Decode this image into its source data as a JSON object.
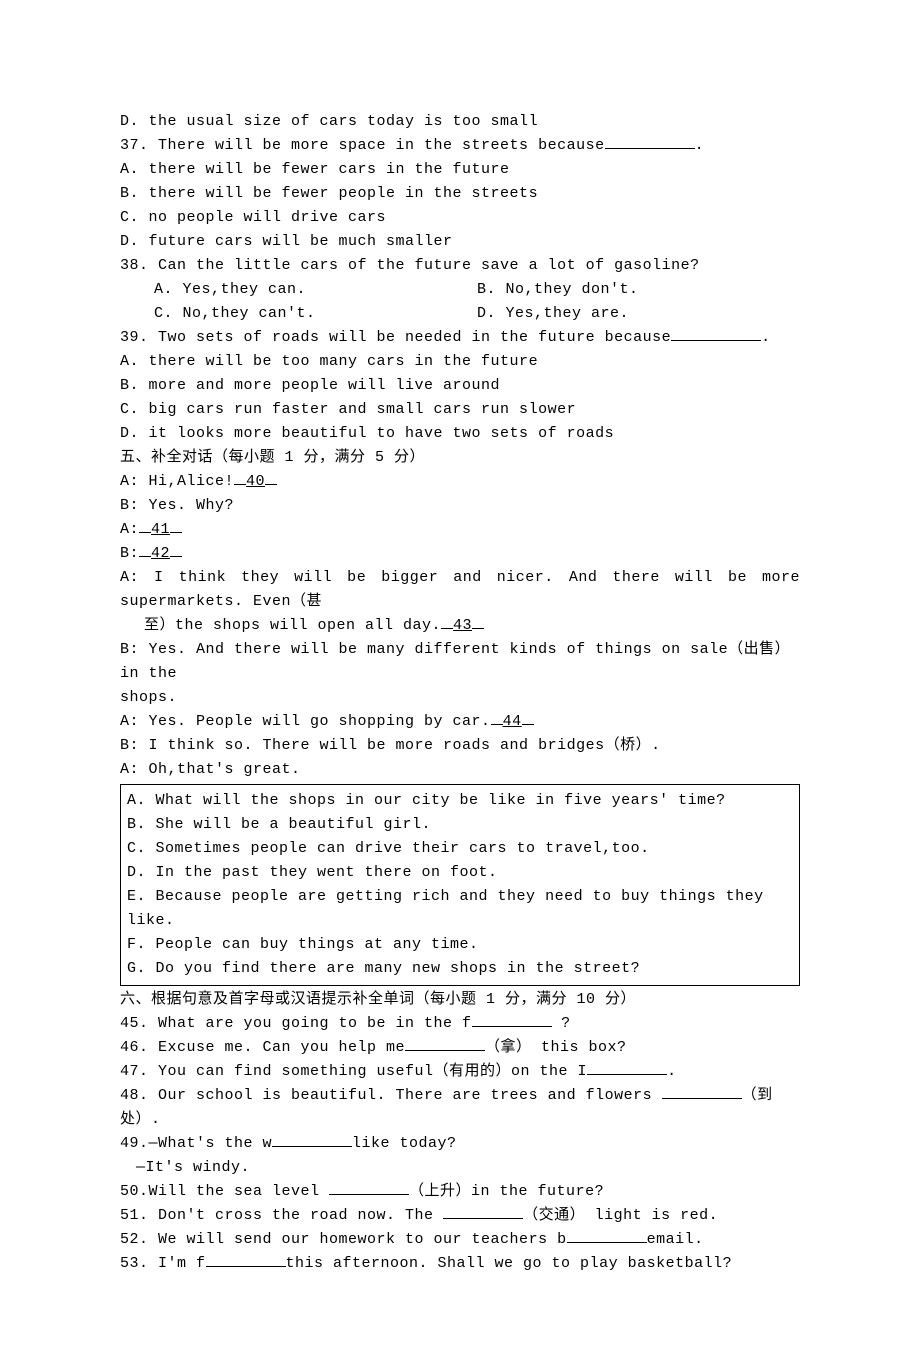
{
  "q36": {
    "optD": "D. the usual size of cars today is too small"
  },
  "q37": {
    "stem_pre": "37. There will be more space in the streets because",
    "stem_post": ".",
    "optA": "A. there will be fewer cars in the future",
    "optB": "B. there will be fewer people in the streets",
    "optC": "C. no people will drive cars",
    "optD": "D. future cars will be much smaller"
  },
  "q38": {
    "stem": "38. Can the little cars of the future save a lot of gasoline?",
    "optA": "A. Yes,they can.",
    "optB": "B. No,they don't.",
    "optC": "C. No,they can't.",
    "optD": "D. Yes,they are."
  },
  "q39": {
    "stem_pre": "39. Two sets of roads will be needed in the future because",
    "stem_post": ".",
    "optA": "A. there will be too many cars in the future",
    "optB": "B. more and more people will live around",
    "optC": "C. big cars run faster and small cars run slower",
    "optD": "D. it looks more beautiful to have two sets of roads"
  },
  "section5_title": "五、补全对话（每小题 1 分，满分 5 分）",
  "dialog": {
    "l1_pre": "A: Hi,Alice!",
    "l1_blank": "40",
    "l2": "B: Yes. Why?",
    "l3_pre": "A:",
    "l3_blank": "41",
    "l4_pre": "B:",
    "l4_blank": "42",
    "l5_a": "A: I think they will be bigger and nicer. And there will be more supermarkets. Even（甚",
    "l5_b_pre": "至）the shops will open all day.",
    "l5_b_blank": "43",
    "l6_a": "B: Yes. And there will be many different kinds of things on sale（出售）in the",
    "l6_b": "shops.",
    "l7_pre": "A: Yes. People will go shopping by car.",
    "l7_blank": "44",
    "l8": "B: I think so. There will be more roads and bridges（桥）.",
    "l9": "A: Oh,that's great."
  },
  "options": {
    "A": "A. What will the shops in our city be like in five years'  time?",
    "B": "B. She will be a beautiful girl.",
    "C": "C. Sometimes people can drive their cars to travel,too.",
    "D": "D. In the past they went there on foot.",
    "E": "E. Because people are getting rich and they need to buy things they like.",
    "F": "F. People can buy things at any time.",
    "G": "G. Do you find there are many new shops in the street?"
  },
  "section6_title": "六、根据句意及首字母或汉语提示补全单词（每小题 1 分，满分 10 分）",
  "fill": {
    "q45_pre": "45. What are you going to be in the f",
    "q45_post": " ?",
    "q46_pre": "46. Excuse me. Can you help me",
    "q46_post": "（拿） this box?",
    "q47_pre": "47. You can find something useful（有用的）on the I",
    "q47_post": ".",
    "q48_pre": "48. Our school is beautiful. There are trees and flowers ",
    "q48_post": "（到处）.",
    "q49a_pre": "49.—What's the w",
    "q49a_post": "like today?",
    "q49b": "—It's windy.",
    "q50_pre": "50.Will the sea level ",
    "q50_post": "（上升）in the future?",
    "q51_pre": "51. Don't cross the road now. The ",
    "q51_post": "（交通） light is red.",
    "q52_pre": "52. We will send our homework to our teachers b",
    "q52_post": "email.",
    "q53_pre": "53. I'm f",
    "q53_post": "this afternoon. Shall we go to play basketball?"
  }
}
